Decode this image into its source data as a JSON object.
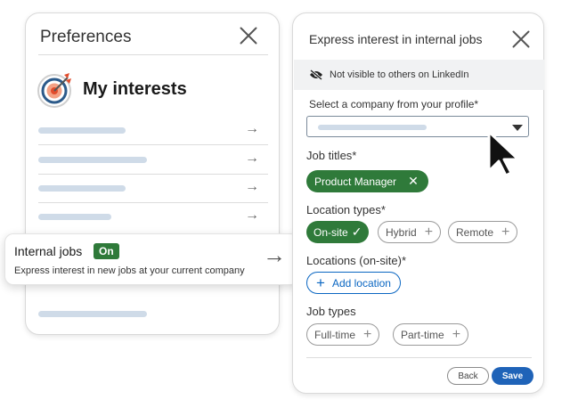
{
  "preferences": {
    "title": "Preferences",
    "heading": "My interests",
    "internal_jobs": {
      "title": "Internal jobs",
      "badge": "On",
      "description": "Express interest in new jobs at your current company"
    }
  },
  "modal": {
    "title": "Express interest in internal jobs",
    "visibility_note": "Not visible to others on LinkedIn",
    "company_label": "Select a company from your profile*",
    "job_titles_label": "Job titles*",
    "job_title_chip": "Product Manager",
    "location_types_label": "Location types*",
    "location_types": [
      "On-site",
      "Hybrid",
      "Remote"
    ],
    "locations_label": "Locations (on-site)*",
    "add_location": "Add location",
    "job_types_label": "Job types",
    "job_types": [
      "Full-time",
      "Part-time"
    ],
    "back_label": "Back",
    "save_label": "Save"
  },
  "colors": {
    "accent_green": "#2f7a3a",
    "link_blue": "#0a66c2",
    "save_blue": "#1f63b8",
    "page_bg": "#ffffff"
  },
  "icons": [
    "close-icon",
    "target-icon",
    "arrow-right-icon",
    "eye-off-icon",
    "chevron-down-icon",
    "check-icon",
    "plus-icon",
    "cursor-icon"
  ]
}
